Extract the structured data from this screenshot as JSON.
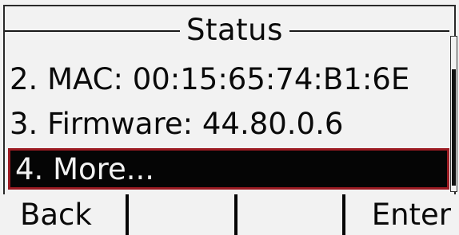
{
  "screen": {
    "title": "Status",
    "items": [
      {
        "text": "2. MAC: 00:15:65:74:B1:6E"
      },
      {
        "text": "3. Firmware: 44.80.0.6"
      },
      {
        "text": "4. More..."
      }
    ],
    "selected_index": 2,
    "scroll_position": 0.85,
    "scroll_visible_fraction": 0.75
  },
  "softkeys": [
    {
      "label": "Back"
    },
    {
      "label": ""
    },
    {
      "label": ""
    },
    {
      "label": "Enter"
    }
  ],
  "colors": {
    "background": "#f2f2f2",
    "text": "#0a0a0a",
    "highlight_bg": "#050505",
    "highlight_border": "#9b1b22"
  }
}
